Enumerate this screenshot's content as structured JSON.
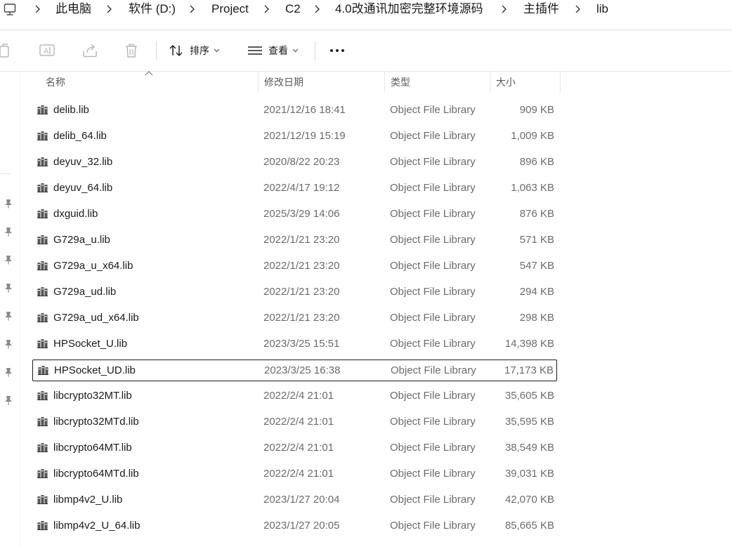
{
  "breadcrumb": [
    {
      "label": "此电脑"
    },
    {
      "label": "软件 (D:)"
    },
    {
      "label": "Project"
    },
    {
      "label": "C2"
    },
    {
      "label": "4.0改通讯加密完整环境源码"
    },
    {
      "label": "主插件"
    },
    {
      "label": "lib"
    }
  ],
  "toolbar": {
    "sort_label": "排序",
    "view_label": "查看"
  },
  "columns": {
    "name": "名称",
    "date": "修改日期",
    "type": "类型",
    "size": "大小"
  },
  "files": [
    {
      "name": "delib.lib",
      "date": "2021/12/16 18:41",
      "type": "Object File Library",
      "size": "909 KB"
    },
    {
      "name": "delib_64.lib",
      "date": "2021/12/19 15:19",
      "type": "Object File Library",
      "size": "1,009 KB"
    },
    {
      "name": "deyuv_32.lib",
      "date": "2020/8/22 20:23",
      "type": "Object File Library",
      "size": "896 KB"
    },
    {
      "name": "deyuv_64.lib",
      "date": "2022/4/17 19:12",
      "type": "Object File Library",
      "size": "1,063 KB"
    },
    {
      "name": "dxguid.lib",
      "date": "2025/3/29 14:06",
      "type": "Object File Library",
      "size": "876 KB"
    },
    {
      "name": "G729a_u.lib",
      "date": "2022/1/21 23:20",
      "type": "Object File Library",
      "size": "571 KB"
    },
    {
      "name": "G729a_u_x64.lib",
      "date": "2022/1/21 23:20",
      "type": "Object File Library",
      "size": "547 KB"
    },
    {
      "name": "G729a_ud.lib",
      "date": "2022/1/21 23:20",
      "type": "Object File Library",
      "size": "294 KB"
    },
    {
      "name": "G729a_ud_x64.lib",
      "date": "2022/1/21 23:20",
      "type": "Object File Library",
      "size": "298 KB"
    },
    {
      "name": "HPSocket_U.lib",
      "date": "2023/3/25 15:51",
      "type": "Object File Library",
      "size": "14,398 KB"
    },
    {
      "name": "HPSocket_UD.lib",
      "date": "2023/3/25 16:38",
      "type": "Object File Library",
      "size": "17,173 KB",
      "selected": true
    },
    {
      "name": "libcrypto32MT.lib",
      "date": "2022/2/4 21:01",
      "type": "Object File Library",
      "size": "35,605 KB"
    },
    {
      "name": "libcrypto32MTd.lib",
      "date": "2022/2/4 21:01",
      "type": "Object File Library",
      "size": "35,595 KB"
    },
    {
      "name": "libcrypto64MT.lib",
      "date": "2022/2/4 21:01",
      "type": "Object File Library",
      "size": "38,549 KB"
    },
    {
      "name": "libcrypto64MTd.lib",
      "date": "2022/2/4 21:01",
      "type": "Object File Library",
      "size": "39,031 KB"
    },
    {
      "name": "libmp4v2_U.lib",
      "date": "2023/1/27 20:04",
      "type": "Object File Library",
      "size": "42,070 KB"
    },
    {
      "name": "libmp4v2_U_64.lib",
      "date": "2023/1/27 20:05",
      "type": "Object File Library",
      "size": "85,665 KB"
    }
  ],
  "icons": {
    "computer": "computer-icon",
    "copy": "copy-icon",
    "rename": "rename-icon",
    "share": "share-icon",
    "delete": "delete-icon",
    "sort": "sort-icon",
    "view": "view-icon",
    "more": "more-icon",
    "pin": "pin-icon",
    "file": "library-file-icon"
  }
}
